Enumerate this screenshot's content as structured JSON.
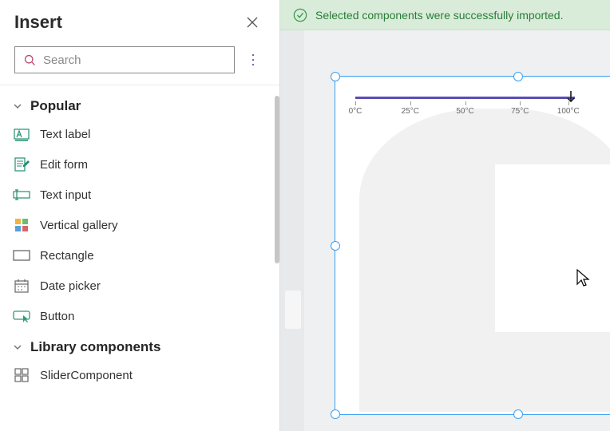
{
  "panel": {
    "title": "Insert",
    "search_placeholder": "Search"
  },
  "groups": [
    {
      "title": "Popular",
      "items": [
        {
          "id": "text-label",
          "label": "Text label",
          "icon": "text-label-icon"
        },
        {
          "id": "edit-form",
          "label": "Edit form",
          "icon": "edit-form-icon"
        },
        {
          "id": "text-input",
          "label": "Text input",
          "icon": "text-input-icon"
        },
        {
          "id": "vertical-gallery",
          "label": "Vertical gallery",
          "icon": "gallery-icon"
        },
        {
          "id": "rectangle",
          "label": "Rectangle",
          "icon": "rectangle-icon"
        },
        {
          "id": "date-picker",
          "label": "Date picker",
          "icon": "date-picker-icon"
        },
        {
          "id": "button",
          "label": "Button",
          "icon": "button-icon"
        }
      ]
    },
    {
      "title": "Library components",
      "items": [
        {
          "id": "slider-component",
          "label": "SliderComponent",
          "icon": "component-icon"
        }
      ]
    }
  ],
  "toast": {
    "message": "Selected components were successfully imported.",
    "icon": "success-icon"
  },
  "slider": {
    "ticks": [
      {
        "pos": 0.0,
        "label": "0°C"
      },
      {
        "pos": 0.25,
        "label": "25°C"
      },
      {
        "pos": 0.5,
        "label": "50°C"
      },
      {
        "pos": 0.75,
        "label": "75°C"
      },
      {
        "pos": 0.97,
        "label": "100°C"
      }
    ],
    "track_color": "#5b4eb5"
  }
}
